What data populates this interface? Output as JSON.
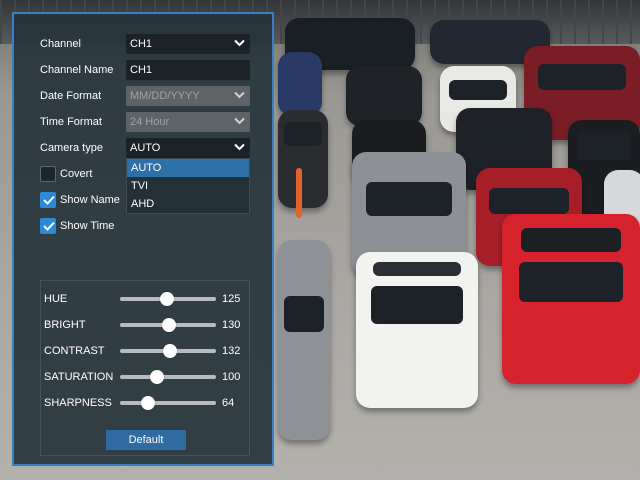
{
  "settings": {
    "channel": {
      "label": "Channel",
      "value": "CH1"
    },
    "channel_name": {
      "label": "Channel Name",
      "value": "CH1"
    },
    "date_format": {
      "label": "Date Format",
      "value": "MM/DD/YYYY"
    },
    "time_format": {
      "label": "Time Format",
      "value": "24 Hour"
    },
    "camera_type": {
      "label": "Camera type",
      "value": "AUTO",
      "options": [
        "AUTO",
        "TVI",
        "AHD"
      ],
      "selected": "AUTO"
    },
    "covert": {
      "label": "Covert",
      "checked": false
    },
    "show_name": {
      "label": "Show Name",
      "checked": true
    },
    "show_time": {
      "label": "Show Time",
      "checked": true
    }
  },
  "image": {
    "sliders": [
      {
        "label": "HUE",
        "value": "125",
        "level": 0.49
      },
      {
        "label": "BRIGHT",
        "value": "130",
        "level": 0.51
      },
      {
        "label": "CONTRAST",
        "value": "132",
        "level": 0.52
      },
      {
        "label": "SATURATION",
        "value": "100",
        "level": 0.39
      },
      {
        "label": "SHARPNESS",
        "value": "64",
        "level": 0.29
      }
    ],
    "default_label": "Default"
  },
  "colors": {
    "panel_border": "#3a7fc2",
    "checkbox_on": "#2b8ad8",
    "selected_option": "#2d6fa7",
    "button": "#2f6aa1"
  },
  "icons": [
    "chevron-down-icon",
    "checkmark-icon"
  ]
}
